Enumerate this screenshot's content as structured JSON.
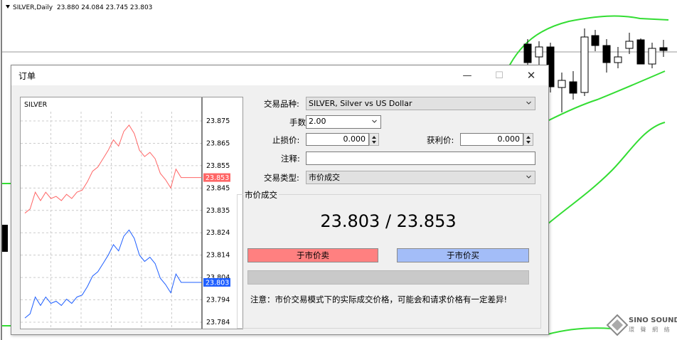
{
  "chart_window": {
    "symbol_period": "SILVER,Daily",
    "ohlc": "23.880 24.084 23.745 23.803"
  },
  "dialog": {
    "title": "订单",
    "buttons": {
      "minimize": "—",
      "maximize": "☐",
      "close": "✕"
    }
  },
  "mini_chart": {
    "symbol": "SILVER",
    "y_ticks": [
      "23.875",
      "23.865",
      "23.855",
      "23.845",
      "23.835",
      "23.824",
      "23.814",
      "23.804",
      "23.794",
      "23.784"
    ],
    "ask_label": "23.853",
    "bid_label": "23.803",
    "ask_color": "#ff6666",
    "bid_color": "#1f5fff"
  },
  "chart_data": {
    "type": "line",
    "ylim": [
      23.784,
      23.88
    ],
    "series": [
      {
        "values": [
          23.836,
          23.838,
          23.846,
          23.842,
          23.846,
          23.843,
          23.844,
          23.842,
          23.845,
          23.843,
          23.846,
          23.847,
          23.851,
          23.856,
          23.858,
          23.862,
          23.866,
          23.871,
          23.868,
          23.875,
          23.878,
          23.874,
          23.866,
          23.863,
          23.865,
          23.862,
          23.855,
          23.852,
          23.848,
          23.857,
          23.853,
          23.853,
          23.853,
          23.853,
          23.853
        ]
      },
      {
        "values": [
          23.786,
          23.788,
          23.796,
          23.792,
          23.796,
          23.793,
          23.794,
          23.792,
          23.795,
          23.793,
          23.796,
          23.797,
          23.801,
          23.806,
          23.808,
          23.812,
          23.816,
          23.821,
          23.818,
          23.825,
          23.828,
          23.824,
          23.816,
          23.813,
          23.815,
          23.812,
          23.805,
          23.802,
          23.798,
          23.807,
          23.803,
          23.803,
          23.803,
          23.803,
          23.803
        ]
      }
    ]
  },
  "form": {
    "symbol_label": "交易品种:",
    "symbol_value": "SILVER, Silver vs US Dollar",
    "volume_label": "手数:",
    "volume_value": "2.00",
    "sl_label": "止损价:",
    "sl_value": "0.000",
    "tp_label": "获利价:",
    "tp_value": "0.000",
    "comment_label": "注释:",
    "comment_value": "",
    "type_label": "交易类型:",
    "type_value": "市价成交"
  },
  "market_group": {
    "title": "市价成交",
    "price_text": "23.803 / 23.853",
    "sell_label": "于市价卖",
    "buy_label": "于市价买",
    "sell_color": "#ff8080",
    "buy_color": "#a3bdf8",
    "notice": "注意：市价交易模式下的实际成交价格，可能会和请求价格有一定差异!"
  },
  "watermark": {
    "line1": "SINO SOUND",
    "line2": "環 聲 網 絡"
  }
}
